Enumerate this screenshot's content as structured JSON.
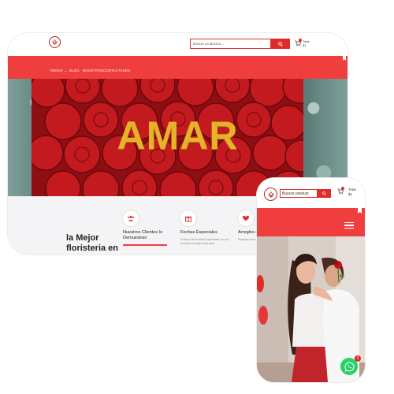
{
  "desktop": {
    "search": {
      "placeholder": "Buscar productos..."
    },
    "cart": {
      "total_label": "Total",
      "total_value": "$1"
    },
    "nav": {
      "items": [
        "TIENDA ⌄",
        "BLOG",
        "NOSOTROS",
        "CONTACTANOS"
      ]
    },
    "hero": {
      "title": "AMAR"
    },
    "headline": "la Mejor floristeria en",
    "features": [
      {
        "icon": "people-icon",
        "title": "Nuestros Clientes lo Demuestran",
        "desc": ""
      },
      {
        "icon": "gift-icon",
        "title": "Fechas Especiales",
        "desc": "Celebra las Fechas Especiales con un hermoso arreglo floral para"
      },
      {
        "icon": "heart-icon",
        "title": "Arreglos m",
        "desc": "Expresar tus nuestros disei"
      }
    ]
  },
  "mobile": {
    "search": {
      "placeholder": "Buscar product"
    },
    "cart": {
      "total_label": "Total",
      "total_value": "$1"
    },
    "whatsapp_badge": "1"
  },
  "colors": {
    "brand_red": "#f03d3d",
    "button_red": "#e02b2b",
    "hero_gold": "#e7b22a",
    "whatsapp_green": "#25d366"
  }
}
